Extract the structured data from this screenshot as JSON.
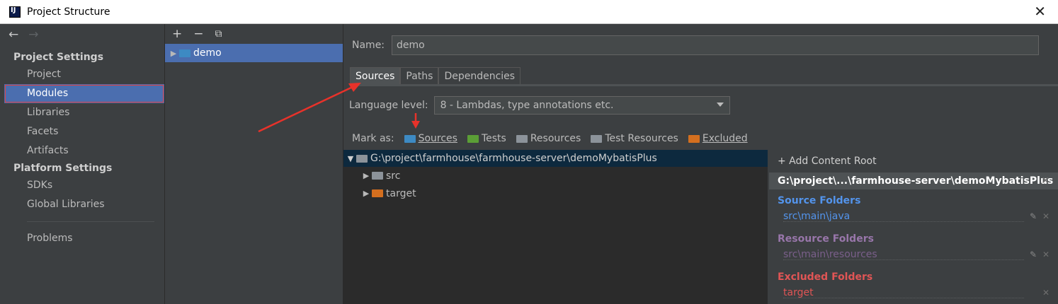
{
  "window": {
    "title": "Project Structure",
    "close_glyph": "✕"
  },
  "nav": {
    "back": "←",
    "forward": "→"
  },
  "sidebar": {
    "project_settings_header": "Project Settings",
    "project_items": [
      "Project",
      "Modules",
      "Libraries",
      "Facets",
      "Artifacts"
    ],
    "platform_settings_header": "Platform Settings",
    "platform_items": [
      "SDKs",
      "Global Libraries"
    ],
    "problems": "Problems",
    "selected": "Modules"
  },
  "modules": {
    "toolbar": {
      "add": "+",
      "remove": "−",
      "copy": "⧉"
    },
    "items": [
      "demo"
    ]
  },
  "module": {
    "name_label": "Name:",
    "name_value": "demo",
    "tabs": [
      "Sources",
      "Paths",
      "Dependencies"
    ],
    "active_tab": "Sources",
    "language_level_label": "Language level:",
    "language_level_value": "8 - Lambdas, type annotations etc.",
    "mark_as_label": "Mark as:",
    "mark_as": [
      "Sources",
      "Tests",
      "Resources",
      "Test Resources",
      "Excluded"
    ],
    "tree": {
      "root": "G:\\project\\farmhouse\\farmhouse-server\\demoMybatisPlus",
      "children": [
        "src",
        "target"
      ]
    }
  },
  "content_root": {
    "add_label": "+ Add Content Root",
    "path_header": "G:\\project\\...\\farmhouse-server\\demoMybatisPlus",
    "source_folders_title": "Source Folders",
    "source_folders": [
      "src\\main\\java"
    ],
    "resource_folders_title": "Resource Folders",
    "resource_folders": [
      "src\\main\\resources"
    ],
    "excluded_folders_title": "Excluded Folders",
    "excluded_folders": [
      "target"
    ]
  },
  "colors": {
    "source": "#5394ec",
    "resource": "#9876aa",
    "excluded": "#e05555",
    "selection": "#4b6eaf",
    "annotation_arrow": "#e8322a"
  }
}
